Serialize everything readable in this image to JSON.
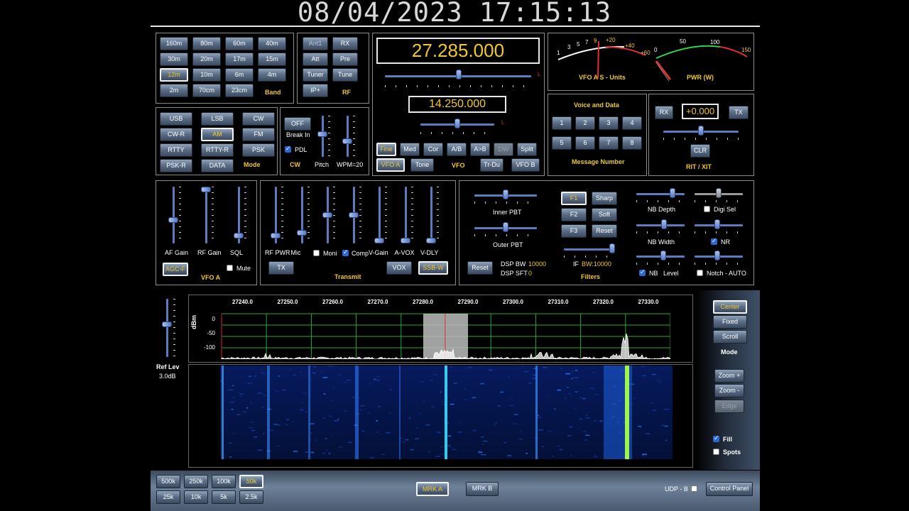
{
  "clock": "08/04/2023 17:15:13",
  "band": {
    "buttons": [
      "160m",
      "80m",
      "60m",
      "40m",
      "30m",
      "20m",
      "17m",
      "15m",
      "12m",
      "10m",
      "6m",
      "4m",
      "2m",
      "70cm",
      "23cm"
    ],
    "selected": "12m",
    "title": "Band"
  },
  "rf": {
    "buttons": [
      "Ant1",
      "RX",
      "Att",
      "Pre",
      "Tuner",
      "Tune",
      "IP+"
    ],
    "title": "RF"
  },
  "vfo": {
    "main_freq": "27.285.000",
    "sub_freq": "14.250.000",
    "step_buttons": [
      "Fine",
      "Med",
      "Cor",
      "A/B",
      "A>B",
      "DW",
      "Split"
    ],
    "vfo_buttons": [
      "VFO A",
      "Tone",
      "Tr-Du",
      "VFO B"
    ],
    "title": "VFO",
    "slider_marker": "L"
  },
  "meters": {
    "smeter_label": "VFO A S - Units",
    "smeter_scale": [
      "1",
      "3",
      "5",
      "7",
      "9",
      "+20",
      "+40",
      "+60"
    ],
    "pwr_label": "PWR (W)",
    "pwr_scale": [
      "0",
      "50",
      "100",
      "150"
    ]
  },
  "mode": {
    "buttons": [
      "USB",
      "LSB",
      "CW",
      "CW-R",
      "AM",
      "FM",
      "RTTY",
      "RTTY-R",
      "PSK",
      "PSK-R",
      "DATA"
    ],
    "selected": "AM",
    "title": "Mode"
  },
  "cw": {
    "off_label": "OFF",
    "breakin_label": "Break In",
    "pdl_label": "PDL",
    "pdl_checked": true,
    "title": "CW",
    "pitch_label": "Pitch",
    "wpm_label": "WPM=20",
    "pitch_level": 0.55,
    "wpm_level": 0.55
  },
  "message": {
    "title": "Voice and Data",
    "buttons": [
      "1",
      "2",
      "3",
      "4",
      "5",
      "6",
      "7",
      "8"
    ],
    "footer": "Message Number"
  },
  "rit": {
    "rx_label": "RX",
    "value": "+0.000",
    "tx_label": "TX",
    "clr_label": "CLR",
    "title": "RIT / XIT"
  },
  "vfoa_panel": {
    "sliders": [
      {
        "label": "AF Gain",
        "level": 0.4
      },
      {
        "label": "RF Gain",
        "level": 1.0
      },
      {
        "label": "SQL",
        "level": 0.1
      }
    ],
    "agc_label": "AGC-F",
    "title": "VFO A",
    "mute_label": "Mute",
    "mute_checked": false
  },
  "transmit": {
    "sliders": [
      {
        "label": "RF PWR",
        "level": 0.1
      },
      {
        "label": "Mic",
        "level": 0.15
      },
      {
        "label": "",
        "level": 0.5
      },
      {
        "label": "",
        "level": 0.5
      },
      {
        "label": "V-Gain",
        "level": 0.0
      },
      {
        "label": "A-VOX",
        "level": 0.0
      },
      {
        "label": "V-DLY",
        "level": 0.0
      }
    ],
    "moni_label": "Moni",
    "moni_checked": false,
    "comp_label": "Comp",
    "comp_checked": true,
    "tx_label": "TX",
    "vox_label": "VOX",
    "ssbw_label": "SSB-W",
    "title": "Transmit"
  },
  "filters": {
    "inner_pbt_label": "Inner PBT",
    "outer_pbt_label": "Outer PBT",
    "reset_label": "Reset",
    "dsp_bw_label": "DSP BW",
    "dsp_bw_value": "10000",
    "dsp_sft_label": "DSP SFT",
    "dsp_sft_value": "0",
    "f_buttons": [
      "F1",
      "F2",
      "F3"
    ],
    "shape_buttons": [
      "Sharp",
      "Soft",
      "Reset"
    ],
    "if_label": "IF",
    "if_bw": "BW:10000",
    "title": "Filters"
  },
  "nb": {
    "nb_depth_label": "NB Depth",
    "digi_sel_label": "Digi Sel",
    "digi_sel_checked": false,
    "nb_width_label": "NB Width",
    "nr_label": "NR",
    "nr_checked": true,
    "nb_label": "NB",
    "nb_checked": true,
    "level_label": "Level",
    "notch_label": "Notch - AUTO",
    "notch_checked": false
  },
  "spectrum": {
    "freq_labels": [
      "27240.0",
      "27250.0",
      "27260.0",
      "27270.0",
      "27280.0",
      "27290.0",
      "27300.0",
      "27310.0",
      "27320.0",
      "27330.0"
    ],
    "db_labels": [
      "0",
      "-50",
      "-100"
    ],
    "y_axis": "dBm",
    "ref_lev_label": "Ref Lev",
    "ref_lev_value": "3.0dB",
    "colors": {
      "grid": "#2aa833",
      "trace": "#ffffff",
      "passband": "#bdbdbd",
      "marker": "#e02020"
    }
  },
  "sidebar": {
    "mode_buttons": [
      "Center",
      "Fixed",
      "Scroll"
    ],
    "selected": "Center",
    "mode_title": "Mode",
    "zoom_in": "Zoom +",
    "zoom_out": "Zoom -",
    "edge": "Edge",
    "fill_label": "Fill",
    "fill_checked": true,
    "spots_label": "Spots",
    "spots_checked": false
  },
  "footer": {
    "span_buttons": [
      "500k",
      "250k",
      "100k",
      "50k",
      "25k",
      "10k",
      "5k",
      "2.5k"
    ],
    "selected_span": "50k",
    "mrk_a": "MRK A",
    "mrk_b": "MRK B",
    "udp_label": "UDP - B",
    "control_panel": "Control Panel"
  }
}
